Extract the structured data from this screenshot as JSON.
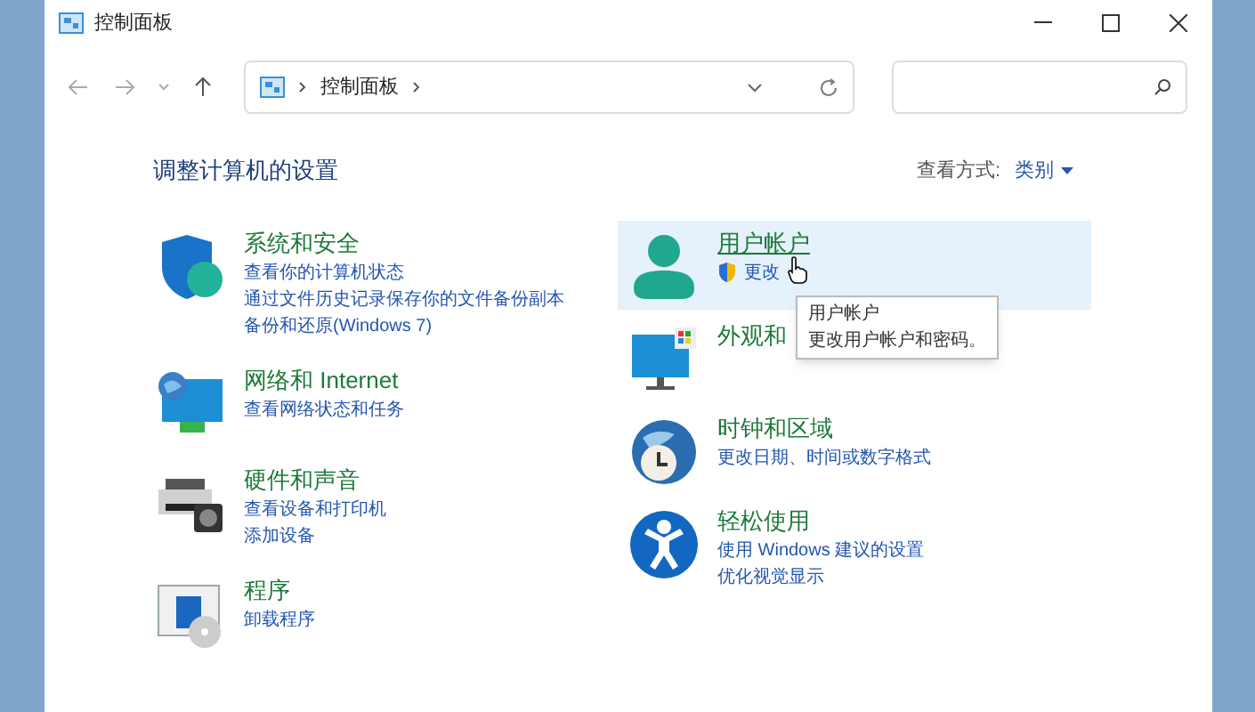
{
  "window": {
    "title": "控制面板"
  },
  "address_bar": {
    "breadcrumb": [
      "控制面板"
    ]
  },
  "heading": "调整计算机的设置",
  "view_by": {
    "label": "查看方式:",
    "value": "类别"
  },
  "columns": [
    {
      "categories": [
        {
          "kind": "security",
          "title": "系统和安全",
          "hovered": false,
          "links": [
            {
              "text": "查看你的计算机状态",
              "shield": false
            },
            {
              "text": "通过文件历史记录保存你的文件备份副本",
              "shield": false
            },
            {
              "text": "备份和还原(Windows 7)",
              "shield": false
            }
          ]
        },
        {
          "kind": "network",
          "title": "网络和 Internet",
          "hovered": false,
          "links": [
            {
              "text": "查看网络状态和任务",
              "shield": false
            }
          ]
        },
        {
          "kind": "hardware",
          "title": "硬件和声音",
          "hovered": false,
          "links": [
            {
              "text": "查看设备和打印机",
              "shield": false
            },
            {
              "text": "添加设备",
              "shield": false
            }
          ]
        },
        {
          "kind": "programs",
          "title": "程序",
          "hovered": false,
          "links": [
            {
              "text": "卸载程序",
              "shield": false
            }
          ]
        }
      ]
    },
    {
      "categories": [
        {
          "kind": "user",
          "title": "用户帐户",
          "hovered": true,
          "links": [
            {
              "text": "更改",
              "shield": true
            }
          ]
        },
        {
          "kind": "appearance",
          "title": "外观和",
          "hovered": false
        },
        {
          "kind": "clock",
          "title": "时钟和区域",
          "hovered": false,
          "links": [
            {
              "text": "更改日期、时间或数字格式",
              "shield": false
            }
          ]
        },
        {
          "kind": "ease",
          "title": "轻松使用",
          "hovered": false,
          "links": [
            {
              "text": "使用 Windows 建议的设置",
              "shield": false
            },
            {
              "text": "优化视觉显示",
              "shield": false
            }
          ]
        }
      ]
    }
  ],
  "tooltip": {
    "title": "用户帐户",
    "text": "更改用户帐户和密码。"
  }
}
